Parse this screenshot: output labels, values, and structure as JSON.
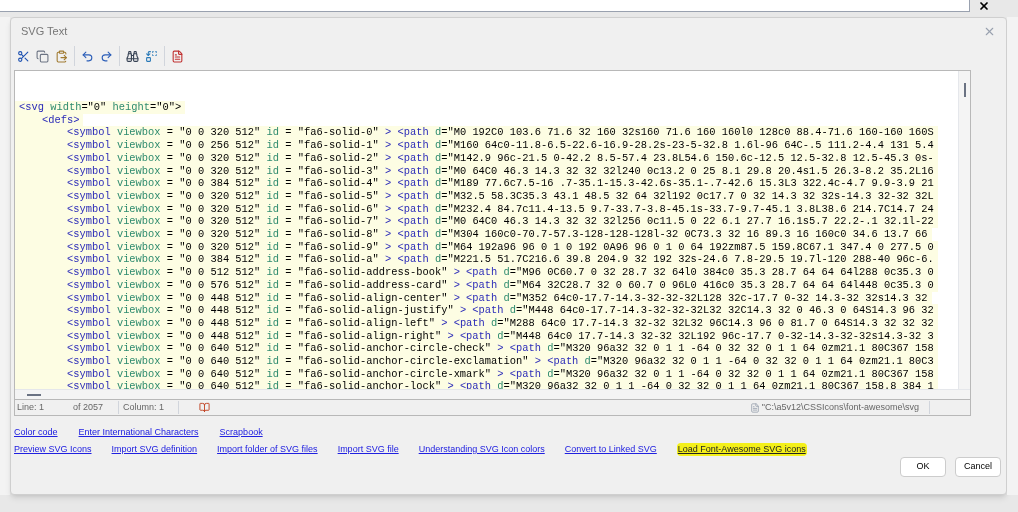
{
  "dialog": {
    "title": "SVG Text"
  },
  "editor": {
    "lines": [
      {
        "tokens": [
          {
            "kind": "tag",
            "text": "<svg"
          },
          {
            "kind": "attr",
            "text": " width"
          },
          {
            "kind": "text",
            "text": "=\"0\" "
          },
          {
            "kind": "attr",
            "text": "height"
          },
          {
            "kind": "text",
            "text": "=\"0\">"
          }
        ],
        "children": [
          {
            "tokens": [
              {
                "kind": "tag",
                "text": "<defs>"
              }
            ],
            "children": [
              {
                "tokens": [
                  {
                    "kind": "tag",
                    "text": "<symbol"
                  },
                  {
                    "kind": "attr",
                    "text": " viewbox"
                  },
                  {
                    "kind": "text",
                    "text": " = \"0 0 320 512\" "
                  },
                  {
                    "kind": "attr",
                    "text": "id"
                  },
                  {
                    "kind": "text",
                    "text": " = \"fa6-solid-0\" "
                  },
                  {
                    "kind": "tag",
                    "text": "> <path"
                  },
                  {
                    "kind": "attr",
                    "text": " d"
                  },
                  {
                    "kind": "text",
                    "text": "=\"M0 192C0 103.6 71.6 32 160 32s160 71.6 160 160l0 128c0 88.4-71.6 160-160 160S"
                  }
                ]
              },
              {
                "tokens": [
                  {
                    "kind": "tag",
                    "text": "<symbol"
                  },
                  {
                    "kind": "attr",
                    "text": " viewbox"
                  },
                  {
                    "kind": "text",
                    "text": " = \"0 0 256 512\" "
                  },
                  {
                    "kind": "attr",
                    "text": "id"
                  },
                  {
                    "kind": "text",
                    "text": " = \"fa6-solid-1\" "
                  },
                  {
                    "kind": "tag",
                    "text": "> <path"
                  },
                  {
                    "kind": "attr",
                    "text": " d"
                  },
                  {
                    "kind": "text",
                    "text": "=\"M160 64c0-11.8-6.5-22.6-16.9-28.2s-23-5-32.8 1.6l-96 64C-.5 111.2-4.4 131 5.4"
                  }
                ]
              },
              {
                "tokens": [
                  {
                    "kind": "tag",
                    "text": "<symbol"
                  },
                  {
                    "kind": "attr",
                    "text": " viewbox"
                  },
                  {
                    "kind": "text",
                    "text": " = \"0 0 320 512\" "
                  },
                  {
                    "kind": "attr",
                    "text": "id"
                  },
                  {
                    "kind": "text",
                    "text": " = \"fa6-solid-2\" "
                  },
                  {
                    "kind": "tag",
                    "text": "> <path"
                  },
                  {
                    "kind": "attr",
                    "text": " d"
                  },
                  {
                    "kind": "text",
                    "text": "=\"M142.9 96c-21.5 0-42.2 8.5-57.4 23.8L54.6 150.6c-12.5 12.5-32.8 12.5-45.3 0s-"
                  }
                ]
              },
              {
                "tokens": [
                  {
                    "kind": "tag",
                    "text": "<symbol"
                  },
                  {
                    "kind": "attr",
                    "text": " viewbox"
                  },
                  {
                    "kind": "text",
                    "text": " = \"0 0 320 512\" "
                  },
                  {
                    "kind": "attr",
                    "text": "id"
                  },
                  {
                    "kind": "text",
                    "text": " = \"fa6-solid-3\" "
                  },
                  {
                    "kind": "tag",
                    "text": "> <path"
                  },
                  {
                    "kind": "attr",
                    "text": " d"
                  },
                  {
                    "kind": "text",
                    "text": "=\"M0 64C0 46.3 14.3 32 32 32l240 0c13.2 0 25 8.1 29.8 20.4s1.5 26.3-8.2 35.2L16"
                  }
                ]
              },
              {
                "tokens": [
                  {
                    "kind": "tag",
                    "text": "<symbol"
                  },
                  {
                    "kind": "attr",
                    "text": " viewbox"
                  },
                  {
                    "kind": "text",
                    "text": " = \"0 0 384 512\" "
                  },
                  {
                    "kind": "attr",
                    "text": "id"
                  },
                  {
                    "kind": "text",
                    "text": " = \"fa6-solid-4\" "
                  },
                  {
                    "kind": "tag",
                    "text": "> <path"
                  },
                  {
                    "kind": "attr",
                    "text": " d"
                  },
                  {
                    "kind": "text",
                    "text": "=\"M189 77.6c7.5-16 .7-35.1-15.3-42.6s-35.1-.7-42.6 15.3L3 322.4c-4.7 9.9-3.9 21"
                  }
                ]
              },
              {
                "tokens": [
                  {
                    "kind": "tag",
                    "text": "<symbol"
                  },
                  {
                    "kind": "attr",
                    "text": " viewbox"
                  },
                  {
                    "kind": "text",
                    "text": " = \"0 0 320 512\" "
                  },
                  {
                    "kind": "attr",
                    "text": "id"
                  },
                  {
                    "kind": "text",
                    "text": " = \"fa6-solid-5\" "
                  },
                  {
                    "kind": "tag",
                    "text": "> <path"
                  },
                  {
                    "kind": "attr",
                    "text": " d"
                  },
                  {
                    "kind": "text",
                    "text": "=\"M32.5 58.3C35.3 43.1 48.5 32 64 32l192 0c17.7 0 32 14.3 32 32s-14.3 32-32 32L"
                  }
                ]
              },
              {
                "tokens": [
                  {
                    "kind": "tag",
                    "text": "<symbol"
                  },
                  {
                    "kind": "attr",
                    "text": " viewbox"
                  },
                  {
                    "kind": "text",
                    "text": " = \"0 0 320 512\" "
                  },
                  {
                    "kind": "attr",
                    "text": "id"
                  },
                  {
                    "kind": "text",
                    "text": " = \"fa6-solid-6\" "
                  },
                  {
                    "kind": "tag",
                    "text": "> <path"
                  },
                  {
                    "kind": "attr",
                    "text": " d"
                  },
                  {
                    "kind": "text",
                    "text": "=\"M232.4 84.7c11.4-13.5 9.7-33.7-3.8-45.1s-33.7-9.7-45.1 3.8L38.6 214.7C14.7 24"
                  }
                ]
              },
              {
                "tokens": [
                  {
                    "kind": "tag",
                    "text": "<symbol"
                  },
                  {
                    "kind": "attr",
                    "text": " viewbox"
                  },
                  {
                    "kind": "text",
                    "text": " = \"0 0 320 512\" "
                  },
                  {
                    "kind": "attr",
                    "text": "id"
                  },
                  {
                    "kind": "text",
                    "text": " = \"fa6-solid-7\" "
                  },
                  {
                    "kind": "tag",
                    "text": "> <path"
                  },
                  {
                    "kind": "attr",
                    "text": " d"
                  },
                  {
                    "kind": "text",
                    "text": "=\"M0 64C0 46.3 14.3 32 32 32l256 0c11.5 0 22 6.1 27.7 16.1s5.7 22.2-.1 32.1l-22"
                  }
                ]
              },
              {
                "tokens": [
                  {
                    "kind": "tag",
                    "text": "<symbol"
                  },
                  {
                    "kind": "attr",
                    "text": " viewbox"
                  },
                  {
                    "kind": "text",
                    "text": " = \"0 0 320 512\" "
                  },
                  {
                    "kind": "attr",
                    "text": "id"
                  },
                  {
                    "kind": "text",
                    "text": " = \"fa6-solid-8\" "
                  },
                  {
                    "kind": "tag",
                    "text": "> <path"
                  },
                  {
                    "kind": "attr",
                    "text": " d"
                  },
                  {
                    "kind": "text",
                    "text": "=\"M304 160c0-70.7-57.3-128-128-128l-32 0C73.3 32 16 89.3 16 160c0 34.6 13.7 66"
                  }
                ]
              },
              {
                "tokens": [
                  {
                    "kind": "tag",
                    "text": "<symbol"
                  },
                  {
                    "kind": "attr",
                    "text": " viewbox"
                  },
                  {
                    "kind": "text",
                    "text": " = \"0 0 320 512\" "
                  },
                  {
                    "kind": "attr",
                    "text": "id"
                  },
                  {
                    "kind": "text",
                    "text": " = \"fa6-solid-9\" "
                  },
                  {
                    "kind": "tag",
                    "text": "> <path"
                  },
                  {
                    "kind": "attr",
                    "text": " d"
                  },
                  {
                    "kind": "text",
                    "text": "=\"M64 192a96 96 0 1 0 192 0A96 96 0 1 0 64 192zm87.5 159.8C67.1 347.4 0 277.5 0"
                  }
                ]
              },
              {
                "tokens": [
                  {
                    "kind": "tag",
                    "text": "<symbol"
                  },
                  {
                    "kind": "attr",
                    "text": " viewbox"
                  },
                  {
                    "kind": "text",
                    "text": " = \"0 0 384 512\" "
                  },
                  {
                    "kind": "attr",
                    "text": "id"
                  },
                  {
                    "kind": "text",
                    "text": " = \"fa6-solid-a\" "
                  },
                  {
                    "kind": "tag",
                    "text": "> <path"
                  },
                  {
                    "kind": "attr",
                    "text": " d"
                  },
                  {
                    "kind": "text",
                    "text": "=\"M221.5 51.7C216.6 39.8 204.9 32 192 32s-24.6 7.8-29.5 19.7l-120 288-40 96c-6."
                  }
                ]
              },
              {
                "tokens": [
                  {
                    "kind": "tag",
                    "text": "<symbol"
                  },
                  {
                    "kind": "attr",
                    "text": " viewbox"
                  },
                  {
                    "kind": "text",
                    "text": " = \"0 0 512 512\" "
                  },
                  {
                    "kind": "attr",
                    "text": "id"
                  },
                  {
                    "kind": "text",
                    "text": " = \"fa6-solid-address-book\" "
                  },
                  {
                    "kind": "tag",
                    "text": "> <path"
                  },
                  {
                    "kind": "attr",
                    "text": " d"
                  },
                  {
                    "kind": "text",
                    "text": "=\"M96 0C60.7 0 32 28.7 32 64l0 384c0 35.3 28.7 64 64 64l288 0c35.3 0"
                  }
                ]
              },
              {
                "tokens": [
                  {
                    "kind": "tag",
                    "text": "<symbol"
                  },
                  {
                    "kind": "attr",
                    "text": " viewbox"
                  },
                  {
                    "kind": "text",
                    "text": " = \"0 0 576 512\" "
                  },
                  {
                    "kind": "attr",
                    "text": "id"
                  },
                  {
                    "kind": "text",
                    "text": " = \"fa6-solid-address-card\" "
                  },
                  {
                    "kind": "tag",
                    "text": "> <path"
                  },
                  {
                    "kind": "attr",
                    "text": " d"
                  },
                  {
                    "kind": "text",
                    "text": "=\"M64 32C28.7 32 0 60.7 0 96L0 416c0 35.3 28.7 64 64 64l448 0c35.3 0"
                  }
                ]
              },
              {
                "tokens": [
                  {
                    "kind": "tag",
                    "text": "<symbol"
                  },
                  {
                    "kind": "attr",
                    "text": " viewbox"
                  },
                  {
                    "kind": "text",
                    "text": " = \"0 0 448 512\" "
                  },
                  {
                    "kind": "attr",
                    "text": "id"
                  },
                  {
                    "kind": "text",
                    "text": " = \"fa6-solid-align-center\" "
                  },
                  {
                    "kind": "tag",
                    "text": "> <path"
                  },
                  {
                    "kind": "attr",
                    "text": " d"
                  },
                  {
                    "kind": "text",
                    "text": "=\"M352 64c0-17.7-14.3-32-32-32L128 32c-17.7 0-32 14.3-32 32s14.3 32"
                  }
                ]
              },
              {
                "tokens": [
                  {
                    "kind": "tag",
                    "text": "<symbol"
                  },
                  {
                    "kind": "attr",
                    "text": " viewbox"
                  },
                  {
                    "kind": "text",
                    "text": " = \"0 0 448 512\" "
                  },
                  {
                    "kind": "attr",
                    "text": "id"
                  },
                  {
                    "kind": "text",
                    "text": " = \"fa6-solid-align-justify\" "
                  },
                  {
                    "kind": "tag",
                    "text": "> <path"
                  },
                  {
                    "kind": "attr",
                    "text": " d"
                  },
                  {
                    "kind": "text",
                    "text": "=\"M448 64c0-17.7-14.3-32-32-32L32 32C14.3 32 0 46.3 0 64S14.3 96 32"
                  }
                ]
              },
              {
                "tokens": [
                  {
                    "kind": "tag",
                    "text": "<symbol"
                  },
                  {
                    "kind": "attr",
                    "text": " viewbox"
                  },
                  {
                    "kind": "text",
                    "text": " = \"0 0 448 512\" "
                  },
                  {
                    "kind": "attr",
                    "text": "id"
                  },
                  {
                    "kind": "text",
                    "text": " = \"fa6-solid-align-left\" "
                  },
                  {
                    "kind": "tag",
                    "text": "> <path"
                  },
                  {
                    "kind": "attr",
                    "text": " d"
                  },
                  {
                    "kind": "text",
                    "text": "=\"M288 64c0 17.7-14.3 32-32 32L32 96C14.3 96 0 81.7 0 64S14.3 32 32 32"
                  }
                ]
              },
              {
                "tokens": [
                  {
                    "kind": "tag",
                    "text": "<symbol"
                  },
                  {
                    "kind": "attr",
                    "text": " viewbox"
                  },
                  {
                    "kind": "text",
                    "text": " = \"0 0 448 512\" "
                  },
                  {
                    "kind": "attr",
                    "text": "id"
                  },
                  {
                    "kind": "text",
                    "text": " = \"fa6-solid-align-right\" "
                  },
                  {
                    "kind": "tag",
                    "text": "> <path"
                  },
                  {
                    "kind": "attr",
                    "text": " d"
                  },
                  {
                    "kind": "text",
                    "text": "=\"M448 64c0 17.7-14.3 32-32 32L192 96c-17.7 0-32-14.3-32-32s14.3-32 3"
                  }
                ]
              },
              {
                "tokens": [
                  {
                    "kind": "tag",
                    "text": "<symbol"
                  },
                  {
                    "kind": "attr",
                    "text": " viewbox"
                  },
                  {
                    "kind": "text",
                    "text": " = \"0 0 640 512\" "
                  },
                  {
                    "kind": "attr",
                    "text": "id"
                  },
                  {
                    "kind": "text",
                    "text": " = \"fa6-solid-anchor-circle-check\" "
                  },
                  {
                    "kind": "tag",
                    "text": "> <path"
                  },
                  {
                    "kind": "attr",
                    "text": " d"
                  },
                  {
                    "kind": "text",
                    "text": "=\"M320 96a32 32 0 1 1 -64 0 32 32 0 1 1 64 0zm21.1 80C367 158"
                  }
                ]
              },
              {
                "tokens": [
                  {
                    "kind": "tag",
                    "text": "<symbol"
                  },
                  {
                    "kind": "attr",
                    "text": " viewbox"
                  },
                  {
                    "kind": "text",
                    "text": " = \"0 0 640 512\" "
                  },
                  {
                    "kind": "attr",
                    "text": "id"
                  },
                  {
                    "kind": "text",
                    "text": " = \"fa6-solid-anchor-circle-exclamation\" "
                  },
                  {
                    "kind": "tag",
                    "text": "> <path"
                  },
                  {
                    "kind": "attr",
                    "text": " d"
                  },
                  {
                    "kind": "text",
                    "text": "=\"M320 96a32 32 0 1 1 -64 0 32 32 0 1 1 64 0zm21.1 80C3"
                  }
                ]
              },
              {
                "tokens": [
                  {
                    "kind": "tag",
                    "text": "<symbol"
                  },
                  {
                    "kind": "attr",
                    "text": " viewbox"
                  },
                  {
                    "kind": "text",
                    "text": " = \"0 0 640 512\" "
                  },
                  {
                    "kind": "attr",
                    "text": "id"
                  },
                  {
                    "kind": "text",
                    "text": " = \"fa6-solid-anchor-circle-xmark\" "
                  },
                  {
                    "kind": "tag",
                    "text": "> <path"
                  },
                  {
                    "kind": "attr",
                    "text": " d"
                  },
                  {
                    "kind": "text",
                    "text": "=\"M320 96a32 32 0 1 1 -64 0 32 32 0 1 1 64 0zm21.1 80C367 158"
                  }
                ]
              },
              {
                "tokens": [
                  {
                    "kind": "tag",
                    "text": "<symbol"
                  },
                  {
                    "kind": "attr",
                    "text": " viewbox"
                  },
                  {
                    "kind": "text",
                    "text": " = \"0 0 640 512\" "
                  },
                  {
                    "kind": "attr",
                    "text": "id"
                  },
                  {
                    "kind": "text",
                    "text": " = \"fa6-solid-anchor-lock\" "
                  },
                  {
                    "kind": "tag",
                    "text": "> <path"
                  },
                  {
                    "kind": "attr",
                    "text": " d"
                  },
                  {
                    "kind": "text",
                    "text": "=\"M320 96a32 32 0 1 1 -64 0 32 32 0 1 1 64 0zm21.1 80C367 158.8 384 1"
                  }
                ]
              }
            ]
          }
        ]
      }
    ]
  },
  "status_bar": {
    "line": "Line: 1",
    "of": "of 2057",
    "column": "Column: 1",
    "path": "\"C:\\a5v12\\CSSIcons\\font-awesome\\svg"
  },
  "links": [
    [
      {
        "label": "Color code",
        "highlighted": false
      },
      {
        "label": "Enter International Characters",
        "highlighted": false
      },
      {
        "label": "Scrapbook",
        "highlighted": false
      }
    ],
    [
      {
        "label": "Preview SVG Icons",
        "highlighted": false
      },
      {
        "label": "Import SVG definition",
        "highlighted": false
      },
      {
        "label": "Import folder of SVG files",
        "highlighted": false
      },
      {
        "label": "Import SVG file",
        "highlighted": false
      },
      {
        "label": "Understanding SVG Icon colors",
        "highlighted": false
      },
      {
        "label": "Convert to Linked SVG",
        "highlighted": false
      },
      {
        "label": "Load Font-Awesome SVG icons",
        "highlighted": true
      }
    ]
  ],
  "buttons": [
    "OK",
    "Cancel"
  ]
}
